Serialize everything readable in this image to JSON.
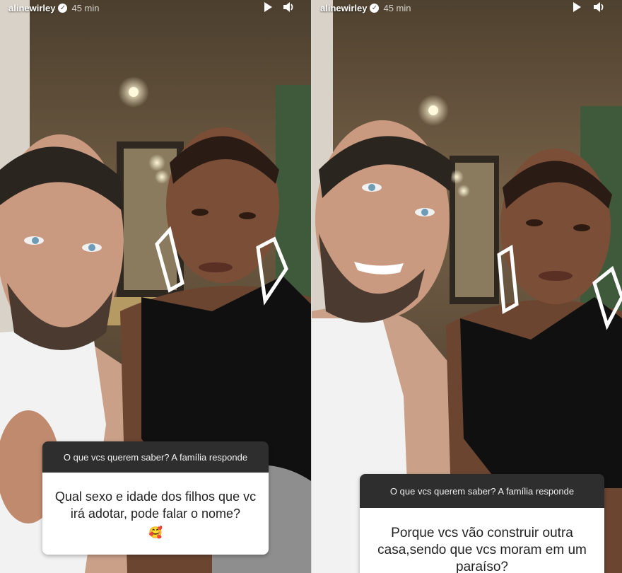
{
  "stories": [
    {
      "username": "alinewirley",
      "time": "45 min",
      "question_prompt": "O que vcs querem saber? A família responde",
      "question_text": "Qual sexo e idade dos  filhos que vc irá adotar, pode falar o nome?",
      "question_emoji": "🥰",
      "icons": [
        "verified-icon",
        "play-icon",
        "volume-icon"
      ]
    },
    {
      "username": "alinewirley",
      "time": "45 min",
      "question_prompt": "O que vcs querem saber? A família responde",
      "question_text": "Porque vcs vão construir outra casa,sendo que vcs moram em um paraíso?",
      "icons": [
        "verified-icon",
        "play-icon",
        "volume-icon"
      ]
    }
  ],
  "colors": {
    "question_header_bg": "#2e2e2e",
    "question_body_bg": "#ffffff",
    "wall": "#6b5a43",
    "ceiling": "#5a4a36"
  }
}
